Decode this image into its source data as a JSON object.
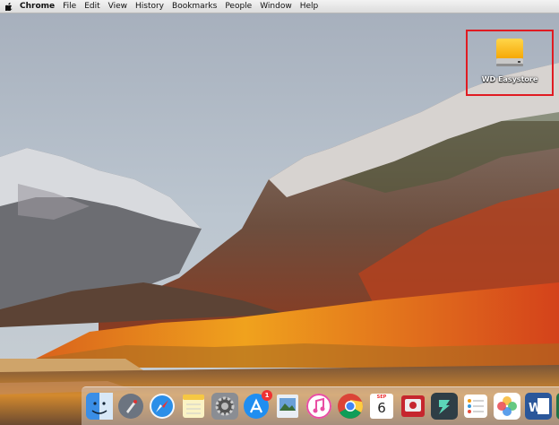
{
  "menubar": {
    "app_name": "Chrome",
    "items": [
      "File",
      "Edit",
      "View",
      "History",
      "Bookmarks",
      "People",
      "Window",
      "Help"
    ]
  },
  "desktop": {
    "drive": {
      "label": "WD Easystore",
      "icon": "external-drive-icon",
      "highlight_color": "#e01b22"
    }
  },
  "dock": {
    "items": [
      {
        "name": "finder",
        "icon": "finder-icon"
      },
      {
        "name": "launchpad",
        "icon": "launchpad-icon"
      },
      {
        "name": "safari",
        "icon": "safari-icon"
      },
      {
        "name": "notes",
        "icon": "notes-icon"
      },
      {
        "name": "system-preferences",
        "icon": "gear-icon"
      },
      {
        "name": "app-store",
        "icon": "app-store-icon",
        "badge": "1"
      },
      {
        "name": "preview",
        "icon": "preview-icon"
      },
      {
        "name": "itunes",
        "icon": "music-icon"
      },
      {
        "name": "chrome",
        "icon": "chrome-icon"
      },
      {
        "name": "calendar",
        "icon": "calendar-icon",
        "month": "SEP",
        "day": "6"
      },
      {
        "name": "photo-booth",
        "icon": "photo-booth-icon"
      },
      {
        "name": "filmora",
        "icon": "filmora-icon"
      },
      {
        "name": "reminders",
        "icon": "reminders-icon"
      },
      {
        "name": "photos",
        "icon": "photos-icon"
      },
      {
        "name": "word",
        "icon": "word-icon"
      },
      {
        "name": "excel",
        "icon": "excel-icon"
      }
    ]
  }
}
